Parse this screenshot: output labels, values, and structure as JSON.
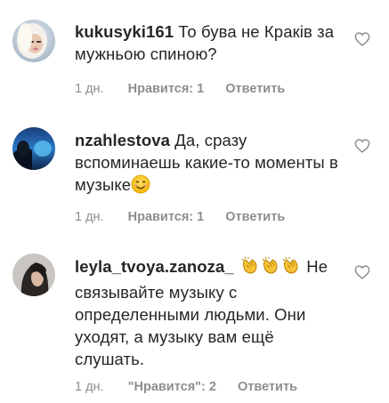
{
  "comments": [
    {
      "username": "kukusyki161",
      "text": "То бува не Краків за мужньою спиною?",
      "time": "1 дн.",
      "likes": "Нравится: 1",
      "reply": "Ответить",
      "avatar_icon": "user-avatar-photo",
      "like_icon": "heart-outline-icon"
    },
    {
      "username": "nzahlestova",
      "text": "Да, сразу вспоминаешь какие-то моменты в музыке",
      "emoji": "smiling-face-emoji",
      "time": "1 дн.",
      "likes": "Нравится: 1",
      "reply": "Ответить",
      "avatar_icon": "user-avatar-photo",
      "like_icon": "heart-outline-icon"
    },
    {
      "username": "leyla_tvoya.zanoza_",
      "emoji": "clapping-hands-emoji x3",
      "text": "Не связывайте музыку с определенными людьми. Они уходят, а музыку вам ещё слушать.",
      "time": "1 дн.",
      "likes": "\"Нравится\": 2",
      "reply": "Ответить",
      "avatar_icon": "user-avatar-photo",
      "like_icon": "heart-outline-icon"
    }
  ]
}
